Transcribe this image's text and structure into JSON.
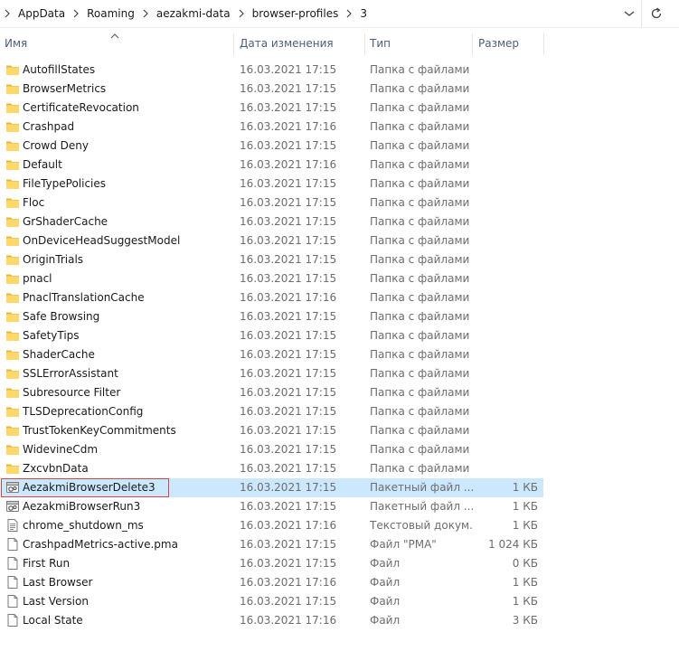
{
  "address": {
    "crumbs": [
      "AppData",
      "Roaming",
      "aezakmi-data",
      "browser-profiles",
      "3"
    ]
  },
  "columns": {
    "name": "Имя",
    "date": "Дата изменения",
    "type": "Тип",
    "size": "Размер"
  },
  "colors": {
    "selection": "#cce8ff",
    "highlight_border": "#d64545",
    "folder": "#ffd86b"
  },
  "files": [
    {
      "icon": "folder-icon",
      "name": "AutofillStates",
      "date": "16.03.2021 17:15",
      "type": "Папка с файлами",
      "size": ""
    },
    {
      "icon": "folder-icon",
      "name": "BrowserMetrics",
      "date": "16.03.2021 17:15",
      "type": "Папка с файлами",
      "size": ""
    },
    {
      "icon": "folder-icon",
      "name": "CertificateRevocation",
      "date": "16.03.2021 17:15",
      "type": "Папка с файлами",
      "size": ""
    },
    {
      "icon": "folder-icon",
      "name": "Crashpad",
      "date": "16.03.2021 17:16",
      "type": "Папка с файлами",
      "size": ""
    },
    {
      "icon": "folder-icon",
      "name": "Crowd Deny",
      "date": "16.03.2021 17:15",
      "type": "Папка с файлами",
      "size": ""
    },
    {
      "icon": "folder-icon",
      "name": "Default",
      "date": "16.03.2021 17:16",
      "type": "Папка с файлами",
      "size": ""
    },
    {
      "icon": "folder-icon",
      "name": "FileTypePolicies",
      "date": "16.03.2021 17:15",
      "type": "Папка с файлами",
      "size": ""
    },
    {
      "icon": "folder-icon",
      "name": "Floc",
      "date": "16.03.2021 17:15",
      "type": "Папка с файлами",
      "size": ""
    },
    {
      "icon": "folder-icon",
      "name": "GrShaderCache",
      "date": "16.03.2021 17:15",
      "type": "Папка с файлами",
      "size": ""
    },
    {
      "icon": "folder-icon",
      "name": "OnDeviceHeadSuggestModel",
      "date": "16.03.2021 17:15",
      "type": "Папка с файлами",
      "size": ""
    },
    {
      "icon": "folder-icon",
      "name": "OriginTrials",
      "date": "16.03.2021 17:15",
      "type": "Папка с файлами",
      "size": ""
    },
    {
      "icon": "folder-icon",
      "name": "pnacl",
      "date": "16.03.2021 17:15",
      "type": "Папка с файлами",
      "size": ""
    },
    {
      "icon": "folder-icon",
      "name": "PnaclTranslationCache",
      "date": "16.03.2021 17:16",
      "type": "Папка с файлами",
      "size": ""
    },
    {
      "icon": "folder-icon",
      "name": "Safe Browsing",
      "date": "16.03.2021 17:15",
      "type": "Папка с файлами",
      "size": ""
    },
    {
      "icon": "folder-icon",
      "name": "SafetyTips",
      "date": "16.03.2021 17:15",
      "type": "Папка с файлами",
      "size": ""
    },
    {
      "icon": "folder-icon",
      "name": "ShaderCache",
      "date": "16.03.2021 17:15",
      "type": "Папка с файлами",
      "size": ""
    },
    {
      "icon": "folder-icon",
      "name": "SSLErrorAssistant",
      "date": "16.03.2021 17:15",
      "type": "Папка с файлами",
      "size": ""
    },
    {
      "icon": "folder-icon",
      "name": "Subresource Filter",
      "date": "16.03.2021 17:15",
      "type": "Папка с файлами",
      "size": ""
    },
    {
      "icon": "folder-icon",
      "name": "TLSDeprecationConfig",
      "date": "16.03.2021 17:15",
      "type": "Папка с файлами",
      "size": ""
    },
    {
      "icon": "folder-icon",
      "name": "TrustTokenKeyCommitments",
      "date": "16.03.2021 17:15",
      "type": "Папка с файлами",
      "size": ""
    },
    {
      "icon": "folder-icon",
      "name": "WidevineCdm",
      "date": "16.03.2021 17:15",
      "type": "Папка с файлами",
      "size": ""
    },
    {
      "icon": "folder-icon",
      "name": "ZxcvbnData",
      "date": "16.03.2021 17:15",
      "type": "Папка с файлами",
      "size": ""
    },
    {
      "icon": "batch-file-icon",
      "name": "AezakmiBrowserDelete3",
      "date": "16.03.2021 17:15",
      "type": "Пакетный файл ...",
      "size": "1 КБ",
      "selected": true
    },
    {
      "icon": "batch-file-icon",
      "name": "AezakmiBrowserRun3",
      "date": "16.03.2021 17:15",
      "type": "Пакетный файл ...",
      "size": "1 КБ"
    },
    {
      "icon": "text-file-icon",
      "name": "chrome_shutdown_ms",
      "date": "16.03.2021 17:16",
      "type": "Текстовый докум...",
      "size": "1 КБ"
    },
    {
      "icon": "file-icon",
      "name": "CrashpadMetrics-active.pma",
      "date": "16.03.2021 17:15",
      "type": "Файл \"PMA\"",
      "size": "1 024 КБ"
    },
    {
      "icon": "file-icon",
      "name": "First Run",
      "date": "16.03.2021 17:15",
      "type": "Файл",
      "size": "0 КБ"
    },
    {
      "icon": "file-icon",
      "name": "Last Browser",
      "date": "16.03.2021 17:16",
      "type": "Файл",
      "size": "1 КБ"
    },
    {
      "icon": "file-icon",
      "name": "Last Version",
      "date": "16.03.2021 17:15",
      "type": "Файл",
      "size": "1 КБ"
    },
    {
      "icon": "file-icon",
      "name": "Local State",
      "date": "16.03.2021 17:16",
      "type": "Файл",
      "size": "3 КБ"
    }
  ]
}
